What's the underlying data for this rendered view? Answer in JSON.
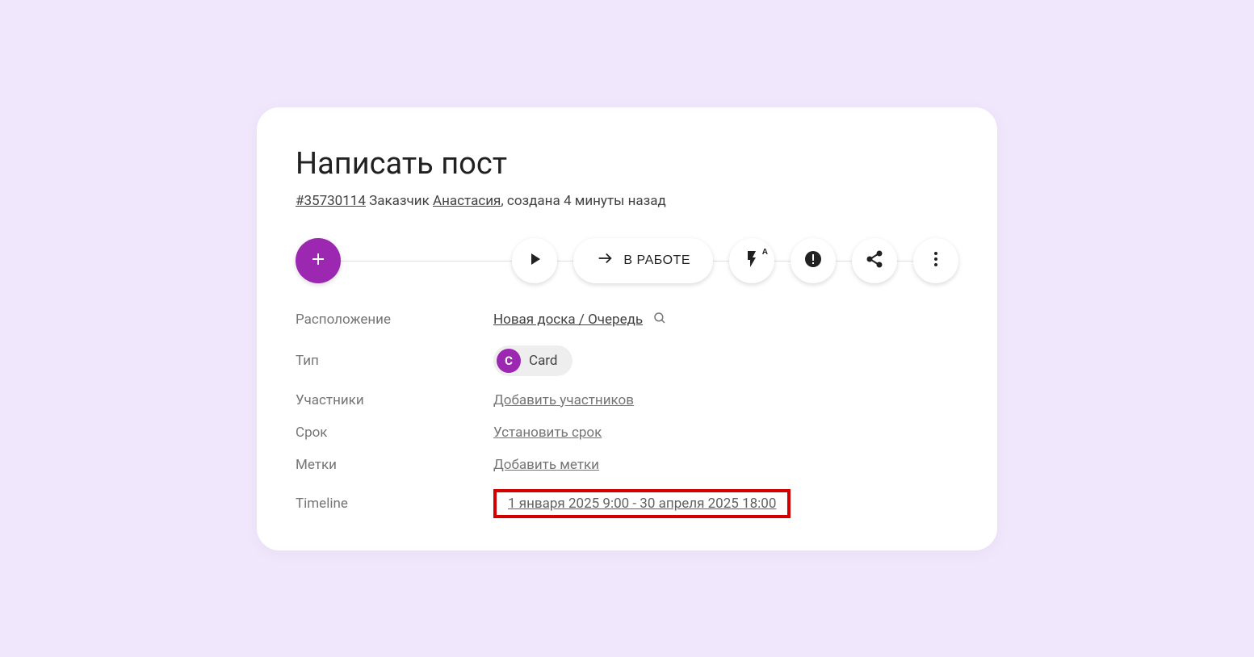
{
  "title": "Написать пост",
  "meta": {
    "id_link": "#35730114",
    "customer_prefix": " Заказчик ",
    "customer_name": "Анастасия",
    "created_suffix": ", создана 4 минуты назад"
  },
  "toolbar": {
    "status_label": "В РАБОТЕ"
  },
  "fields": {
    "location": {
      "label": "Расположение",
      "value": "Новая доска / Очередь"
    },
    "type": {
      "label": "Тип",
      "badge": "C",
      "value": "Card"
    },
    "participants": {
      "label": "Участники",
      "placeholder": "Добавить участников"
    },
    "due": {
      "label": "Срок",
      "placeholder": "Установить срок"
    },
    "tags": {
      "label": "Метки",
      "placeholder": "Добавить метки"
    },
    "timeline": {
      "label": "Timeline",
      "value": "1 января 2025 9:00 - 30 апреля 2025 18:00"
    }
  }
}
